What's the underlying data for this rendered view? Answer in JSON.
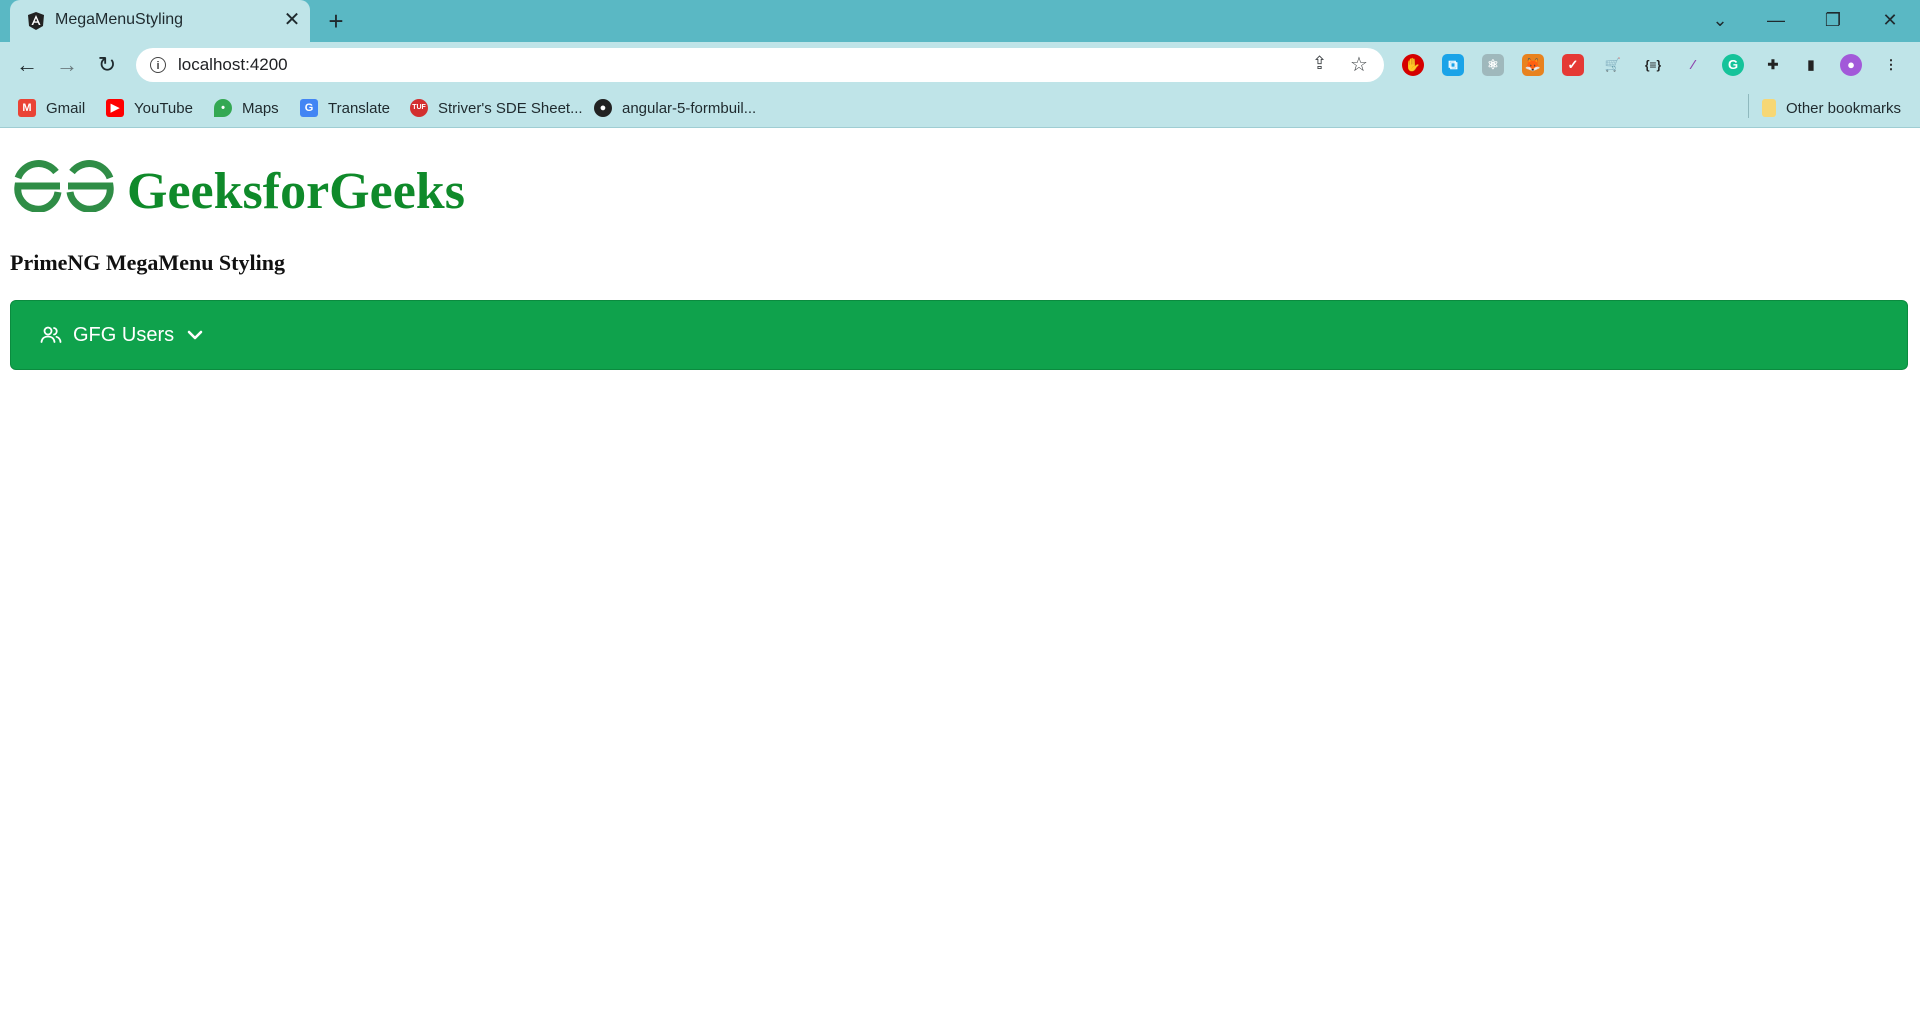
{
  "browser": {
    "tab_title": "MegaMenuStyling",
    "tab_close": "✕",
    "new_tab": "+",
    "window_controls": {
      "tabsearch": "⌄",
      "minimize": "—",
      "restore": "❐",
      "close": "✕"
    },
    "nav": {
      "back": "←",
      "forward": "→",
      "reload": "↻"
    },
    "url": "localhost:4200",
    "bookmarks": [
      {
        "label": "Gmail",
        "icon": "gmail-icon",
        "color": "#ea4335"
      },
      {
        "label": "YouTube",
        "icon": "youtube-icon",
        "color": "#ff0000"
      },
      {
        "label": "Maps",
        "icon": "maps-icon",
        "color": "#34a853"
      },
      {
        "label": "Translate",
        "icon": "translate-icon",
        "color": "#4285f4"
      },
      {
        "label": "Striver's SDE Sheet...",
        "icon": "tuf-icon",
        "color": "#d32f2f"
      },
      {
        "label": "angular-5-formbuil...",
        "icon": "github-icon",
        "color": "#222222"
      }
    ],
    "other_bookmarks": "Other bookmarks"
  },
  "page": {
    "brand": "GeeksforGeeks",
    "subtitle": "PrimeNG MegaMenu Styling",
    "menu": {
      "item_label": "GFG Users",
      "icon": "users-icon",
      "expand_icon": "chevron-down-icon"
    }
  },
  "colors": {
    "chrome_tabstrip": "#5ab8c4",
    "chrome_toolbar": "#bfe4e8",
    "brand_green": "#0f8a2a",
    "menu_green": "#0fa24c"
  }
}
